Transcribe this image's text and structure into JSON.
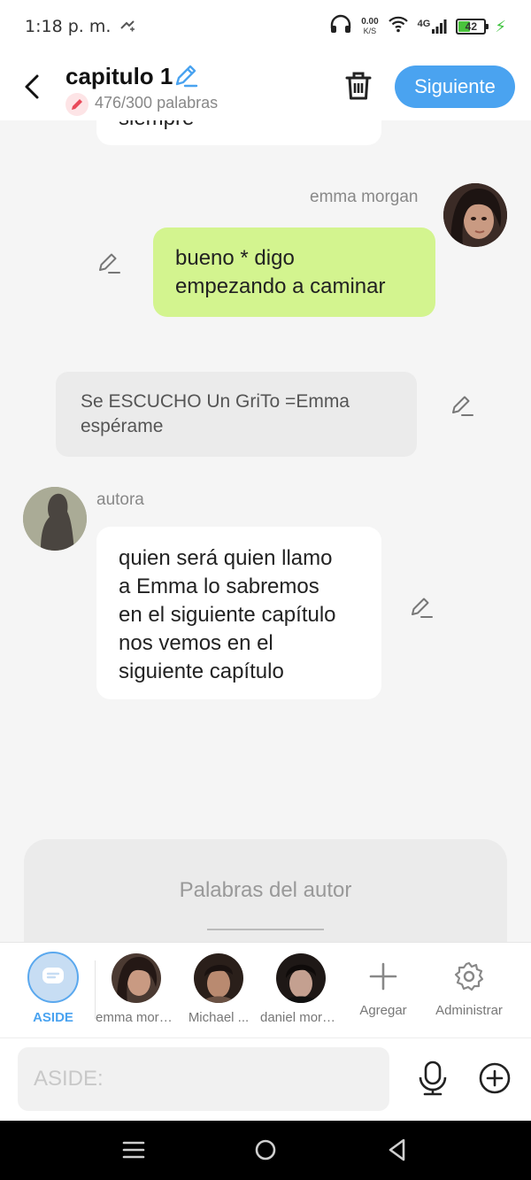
{
  "status_bar": {
    "time": "1:18 p. m.",
    "net_speed_value": "0.00",
    "net_speed_unit": "K/S",
    "network": "4G",
    "battery": "42"
  },
  "header": {
    "title": "capitulo 1",
    "word_count": "476/300 palabras",
    "next_button": "Siguiente"
  },
  "messages": [
    {
      "sender": "",
      "text": "siempre"
    },
    {
      "sender": "emma morgan",
      "text": "bueno * digo\nempezando a caminar"
    },
    {
      "sender": "",
      "text": "Se ESCUCHO Un GriTo =Emma\nespérame"
    },
    {
      "sender": "autora",
      "text": "quien será quien llamo\na Emma lo sabremos\nen el siguiente capítulo\nnos vemos en el\nsiguiente capítulo"
    }
  ],
  "author_words": {
    "label": "Palabras del autor"
  },
  "characters": [
    {
      "label": "ASIDE"
    },
    {
      "label": "emma morgan"
    },
    {
      "label": "Michael ..."
    },
    {
      "label": "daniel morgan"
    },
    {
      "label": "Agregar"
    },
    {
      "label": "Administrar"
    }
  ],
  "input": {
    "placeholder": "ASIDE:"
  },
  "colors": {
    "accent": "#4aa3f0",
    "green_bubble": "#d3f48f",
    "gray_bubble": "#ebebeb",
    "background": "#f5f5f5"
  }
}
